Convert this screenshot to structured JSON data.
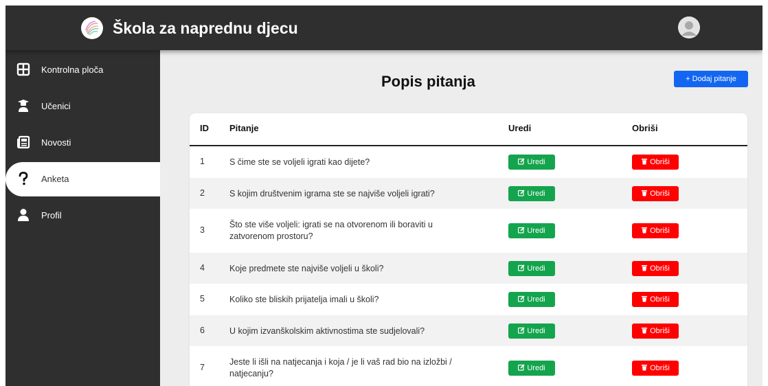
{
  "header": {
    "title": "Škola za naprednu djecu",
    "logo_icon": "school-logo-icon",
    "avatar_icon": "user-avatar-icon"
  },
  "sidebar": {
    "items": [
      {
        "label": "Kontrolna ploča",
        "icon": "dashboard-grid-icon"
      },
      {
        "label": "Učenici",
        "icon": "graduate-icon"
      },
      {
        "label": "Novosti",
        "icon": "newspaper-icon"
      },
      {
        "label": "Anketa",
        "icon": "question-mark-icon",
        "active": true
      },
      {
        "label": "Profil",
        "icon": "user-icon"
      }
    ]
  },
  "main": {
    "title": "Popis pitanja",
    "add_button": "+ Dodaj pitanje"
  },
  "table": {
    "columns": [
      "ID",
      "Pitanje",
      "Uredi",
      "Obriši"
    ],
    "edit_label": "Uredi",
    "delete_label": "Obriši",
    "rows": [
      {
        "id": "1",
        "question": "S čime ste se voljeli igrati kao dijete?"
      },
      {
        "id": "2",
        "question": "S kojim društvenim igrama ste se najviše voljeli igrati?"
      },
      {
        "id": "3",
        "question": "Što ste više voljeli: igrati se na otvorenom ili boraviti u zatvorenom prostoru?"
      },
      {
        "id": "4",
        "question": "Koje predmete ste najviše voljeli u školi?"
      },
      {
        "id": "5",
        "question": "Koliko ste bliskih prijatelja imali u školi?"
      },
      {
        "id": "6",
        "question": "U kojim izvanškolskim aktivnostima ste sudjelovali?"
      },
      {
        "id": "7",
        "question": "Jeste li išli na natjecanja i koja / je li vaš rad bio na izložbi / natjecanju?"
      }
    ]
  },
  "colors": {
    "sidebar": "#2f2f2f",
    "primary": "#1266f1",
    "edit": "#14a44d",
    "delete": "#ff0000"
  }
}
